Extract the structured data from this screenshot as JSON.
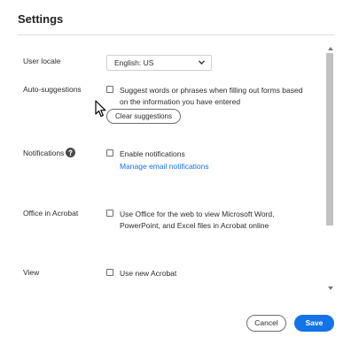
{
  "dialog": {
    "title": "Settings"
  },
  "settings": {
    "user_locale": {
      "label": "User locale",
      "selected_value": "English: US"
    },
    "auto_suggestions": {
      "label": "Auto-suggestions",
      "checkbox_line1": "Suggest words or phrases when filling out forms based",
      "checkbox_line2": "on the information you have entered",
      "checked": false,
      "clear_button": "Clear suggestions"
    },
    "notifications": {
      "label": "Notifications",
      "checkbox_label": "Enable notifications",
      "checked": false,
      "manage_link": "Manage email notifications"
    },
    "office_in_acrobat": {
      "label": "Office in Acrobat",
      "checkbox_line1": "Use Office for the web to view Microsoft Word,",
      "checkbox_line2": "PowerPoint, and Excel files in Acrobat online",
      "checked": false
    },
    "view": {
      "label": "View",
      "checkbox_label": "Use new Acrobat",
      "checked": false
    }
  },
  "footer": {
    "cancel_label": "Cancel",
    "save_label": "Save"
  },
  "colors": {
    "accent": "#1473e6",
    "link": "#1473e6",
    "text": "#2c2c2c"
  },
  "icons": {
    "help": "help-circle-icon",
    "dropdown": "chevron-down-icon",
    "cursor": "mouse-pointer-icon"
  }
}
